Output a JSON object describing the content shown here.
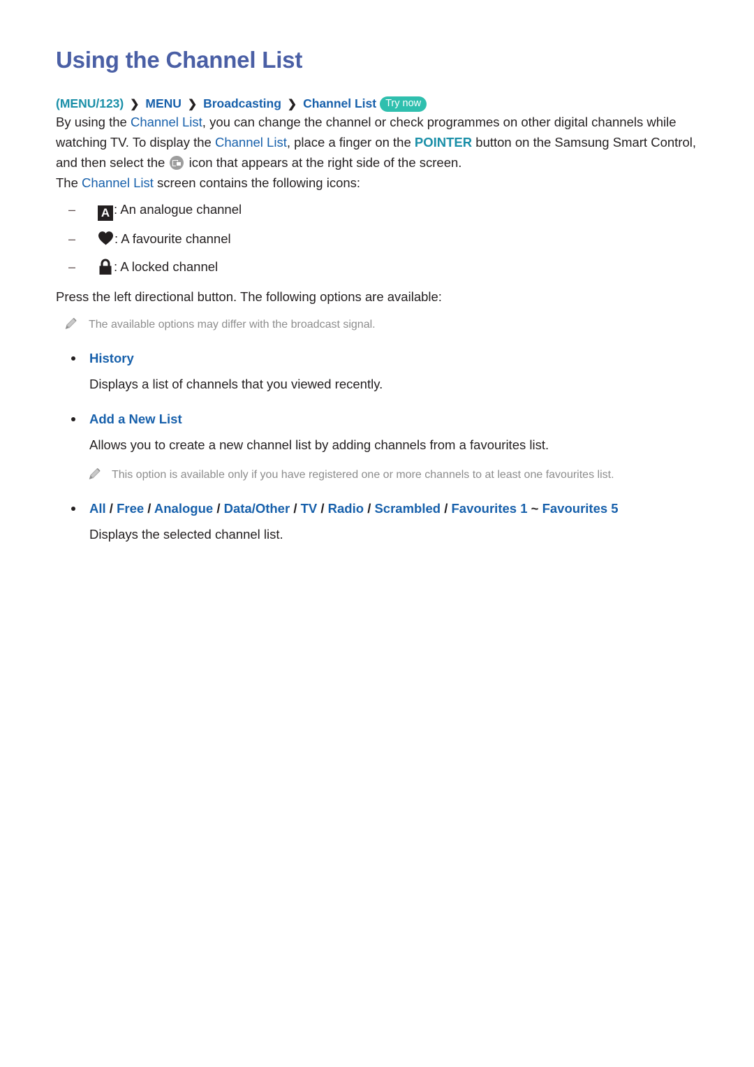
{
  "document": {
    "title": "Using the Channel List",
    "breadcrumb": {
      "menu123": "(MENU/123)",
      "sep": "❯",
      "menu": "MENU",
      "broadcasting": "Broadcasting",
      "channel_list": "Channel List",
      "try_now": "Try now"
    },
    "intro": {
      "t1": "By using the ",
      "link1": "Channel List",
      "t2": ", you can change the channel or check programmes on other digital channels while watching TV. To display the ",
      "link2": "Channel List",
      "t3": ", place a finger on the ",
      "pointer": "POINTER",
      "t4": " button on the Samsung Smart Control, and then select the ",
      "icon_name": "channel-list-icon",
      "t5": " icon that appears at the right side of the screen."
    },
    "icons_intro": {
      "t1": "The ",
      "link": "Channel List",
      "t2": " screen contains the following icons:"
    },
    "icon_items": [
      {
        "mark": "–",
        "icon": "analogue-a-icon",
        "glyph": "A",
        "label": ": An analogue channel"
      },
      {
        "mark": "–",
        "icon": "favourite-heart-icon",
        "glyph": "",
        "label": ": A favourite channel"
      },
      {
        "mark": "–",
        "icon": "locked-padlock-icon",
        "glyph": "",
        "label": ": A locked channel"
      }
    ],
    "press_line": "Press the left directional button. The following options are available:",
    "note_1": "The available options may differ with the broadcast signal.",
    "note_2": "This option is available only if you have registered one or more channels to at least one favourites list.",
    "options": [
      {
        "heading": "History",
        "description": "Displays a list of channels that you viewed recently."
      },
      {
        "heading": "Add a New List",
        "description": "Allows you to create a new channel list by adding channels from a favourites list."
      }
    ],
    "filter_option": {
      "parts": [
        "All",
        "Free",
        "Analogue",
        "Data/Other",
        "TV",
        "Radio",
        "Scrambled",
        "Favourites 1"
      ],
      "separator": "/",
      "tilde": "~",
      "last": "Favourites 5",
      "description": "Displays the selected channel list."
    },
    "colors": {
      "title": "#4a5fa5",
      "link_blue": "#1760ab",
      "teal": "#1a8fa8",
      "pill": "#2fbfae",
      "body": "#231f20",
      "note_grey": "#8d8d8d"
    }
  }
}
